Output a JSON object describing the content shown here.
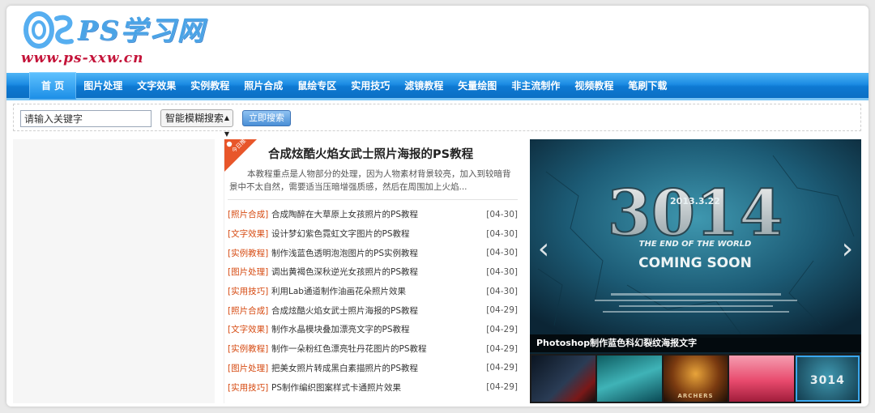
{
  "brand": {
    "logo_text": "PS学习网",
    "url": "www.ps-xxw.cn"
  },
  "nav": [
    {
      "label": "首 页",
      "active": true
    },
    {
      "label": "图片处理"
    },
    {
      "label": "文字效果"
    },
    {
      "label": "实例教程"
    },
    {
      "label": "照片合成"
    },
    {
      "label": "鼠绘专区"
    },
    {
      "label": "实用技巧"
    },
    {
      "label": "滤镜教程"
    },
    {
      "label": "矢量绘图"
    },
    {
      "label": "非主流制作"
    },
    {
      "label": "视频教程"
    },
    {
      "label": "笔刷下载"
    }
  ],
  "search": {
    "placeholder": "请输入关键字",
    "mode": "智能模糊搜索",
    "button": "立即搜索"
  },
  "feature": {
    "badge": "今日推",
    "title": "合成炫酷火焰女武士照片海报的PS教程",
    "description": "本教程重点是人物部分的处理，因为人物素材背景较亮，加入到较暗背景中不太自然，需要适当压暗增强质感，然后在周围加上火焰..."
  },
  "news": [
    {
      "category": "[照片合成]",
      "title": "合成陶醉在大草原上女孩照片的PS教程",
      "date": "[04-30]"
    },
    {
      "category": "[文字效果]",
      "title": "设计梦幻紫色霓虹文字图片的PS教程",
      "date": "[04-30]"
    },
    {
      "category": "[实例教程]",
      "title": "制作浅蓝色透明泡泡图片的PS实例教程",
      "date": "[04-30]"
    },
    {
      "category": "[图片处理]",
      "title": "调出黄褐色深秋逆光女孩照片的PS教程",
      "date": "[04-30]"
    },
    {
      "category": "[实用技巧]",
      "title": "利用Lab通道制作油画花朵照片效果",
      "date": "[04-30]"
    },
    {
      "category": "[照片合成]",
      "title": "合成炫酷火焰女武士照片海报的PS教程",
      "date": "[04-29]"
    },
    {
      "category": "[文字效果]",
      "title": "制作水晶模块叠加漂亮文字的PS教程",
      "date": "[04-29]"
    },
    {
      "category": "[实例教程]",
      "title": "制作一朵粉红色漂亮牡丹花图片的PS教程",
      "date": "[04-29]"
    },
    {
      "category": "[图片处理]",
      "title": "把美女照片转成黑白素描照片的PS教程",
      "date": "[04-29]"
    },
    {
      "category": "[实用技巧]",
      "title": "PS制作编织图案样式卡通照片效果",
      "date": "[04-29]"
    }
  ],
  "slider": {
    "big_number": "3014",
    "date_line": "2013.3.22",
    "tagline": "THE END OF THE WORLD",
    "coming": "COMING SOON",
    "caption": "Photoshop制作蓝色科幻裂纹海报文字",
    "thumbs": [
      {
        "label": ""
      },
      {
        "label": ""
      },
      {
        "label": "ARCHERS"
      },
      {
        "label": ""
      },
      {
        "label": "3014",
        "active": true
      }
    ]
  }
}
